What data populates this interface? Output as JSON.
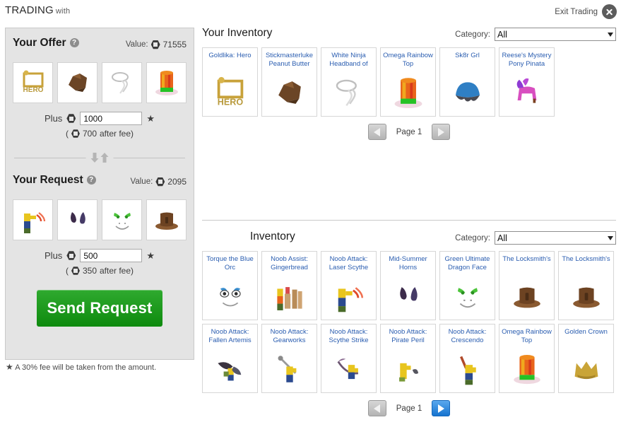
{
  "header": {
    "title": "TRADING",
    "with_label": "with",
    "exit_label": "Exit Trading",
    "close_icon": "close-circle-icon"
  },
  "colors": {
    "panel_bg": "#e4e4e4",
    "link_blue": "#2a5db0",
    "send_green": "#0e8a0e",
    "pager_blue": "#1573cf"
  },
  "offer": {
    "title": "Your Offer",
    "help_icon": "help-icon",
    "value_label": "Value:",
    "value": "71555",
    "robux_icon": "robux-icon",
    "plus_label": "Plus",
    "amount": "1000",
    "star": "★",
    "after_fee_open": "(",
    "after_fee_value": "700",
    "after_fee_text": "after fee)",
    "items": [
      {
        "name": "Goldlika: Hero",
        "thumb": "goldlika-hero-icon"
      },
      {
        "name": "Stickmasterluke Peanut Butter",
        "thumb": "peanut-butter-icon"
      },
      {
        "name": "White Ninja Headband of",
        "thumb": "white-ninja-headband-icon"
      },
      {
        "name": "Omega Rainbow Top",
        "thumb": "omega-rainbow-top-hat-icon"
      }
    ]
  },
  "request": {
    "title": "Your Request",
    "help_icon": "help-icon",
    "value_label": "Value:",
    "value": "2095",
    "plus_label": "Plus",
    "amount": "500",
    "star": "★",
    "after_fee_open": "(",
    "after_fee_value": "350",
    "after_fee_text": "after fee)",
    "items": [
      {
        "name": "Noob Attack: Laser Scythe",
        "thumb": "noob-laser-scythe-icon"
      },
      {
        "name": "Mid-Summer Horns",
        "thumb": "mid-summer-horns-icon"
      },
      {
        "name": "Green Ultimate Dragon Face",
        "thumb": "green-dragon-face-icon"
      },
      {
        "name": "The Locksmith's",
        "thumb": "locksmith-hat-icon"
      }
    ]
  },
  "send_button": "Send Request",
  "fee_note": "A 30% fee will be taken from the amount.",
  "fee_note_star": "★",
  "your_inventory": {
    "title": "Your Inventory",
    "category_label": "Category:",
    "category_value": "All",
    "items": [
      {
        "name": "Goldlika: Hero",
        "thumb": "goldlika-hero-icon"
      },
      {
        "name": "Stickmasterluke Peanut Butter",
        "thumb": "peanut-butter-icon"
      },
      {
        "name": "White Ninja Headband of",
        "thumb": "white-ninja-headband-icon"
      },
      {
        "name": "Omega Rainbow Top",
        "thumb": "omega-rainbow-top-hat-icon"
      },
      {
        "name": "Sk8r Grl",
        "thumb": "sk8r-grl-hair-icon"
      },
      {
        "name": "Reese's Mystery Pony Pinata",
        "thumb": "pony-pinata-icon"
      }
    ],
    "pager": {
      "prev_icon": "prev-arrow-icon",
      "label": "Page 1",
      "next_icon": "next-arrow-icon",
      "prev_enabled": false,
      "next_enabled": false
    }
  },
  "partner_inventory": {
    "title": "Inventory",
    "category_label": "Category:",
    "category_value": "All",
    "items": [
      {
        "name": "Torque the Blue Orc",
        "thumb": "torque-blue-orc-icon"
      },
      {
        "name": "Noob Assist: Gingerbread",
        "thumb": "noob-gingerbread-icon"
      },
      {
        "name": "Noob Attack: Laser Scythe",
        "thumb": "noob-laser-scythe-icon"
      },
      {
        "name": "Mid-Summer Horns",
        "thumb": "mid-summer-horns-icon"
      },
      {
        "name": "Green Ultimate Dragon Face",
        "thumb": "green-dragon-face-icon"
      },
      {
        "name": "The Locksmith's",
        "thumb": "locksmith-hat-icon"
      },
      {
        "name": "The Locksmith's",
        "thumb": "locksmith-hat-icon"
      },
      {
        "name": "Noob Attack: Fallen Artemis",
        "thumb": "noob-fallen-artemis-icon"
      },
      {
        "name": "Noob Attack: Gearworks",
        "thumb": "noob-gearworks-icon"
      },
      {
        "name": "Noob Attack: Scythe Strike",
        "thumb": "noob-scythe-strike-icon"
      },
      {
        "name": "Noob Attack: Pirate Peril",
        "thumb": "noob-pirate-peril-icon"
      },
      {
        "name": "Noob Attack: Crescendo",
        "thumb": "noob-crescendo-icon"
      },
      {
        "name": "Omega Rainbow Top",
        "thumb": "omega-rainbow-top-hat-icon"
      },
      {
        "name": "Golden Crown",
        "thumb": "golden-crown-icon"
      }
    ],
    "pager": {
      "prev_icon": "prev-arrow-icon",
      "label": "Page 1",
      "next_icon": "next-arrow-icon",
      "prev_enabled": false,
      "next_enabled": true
    }
  }
}
